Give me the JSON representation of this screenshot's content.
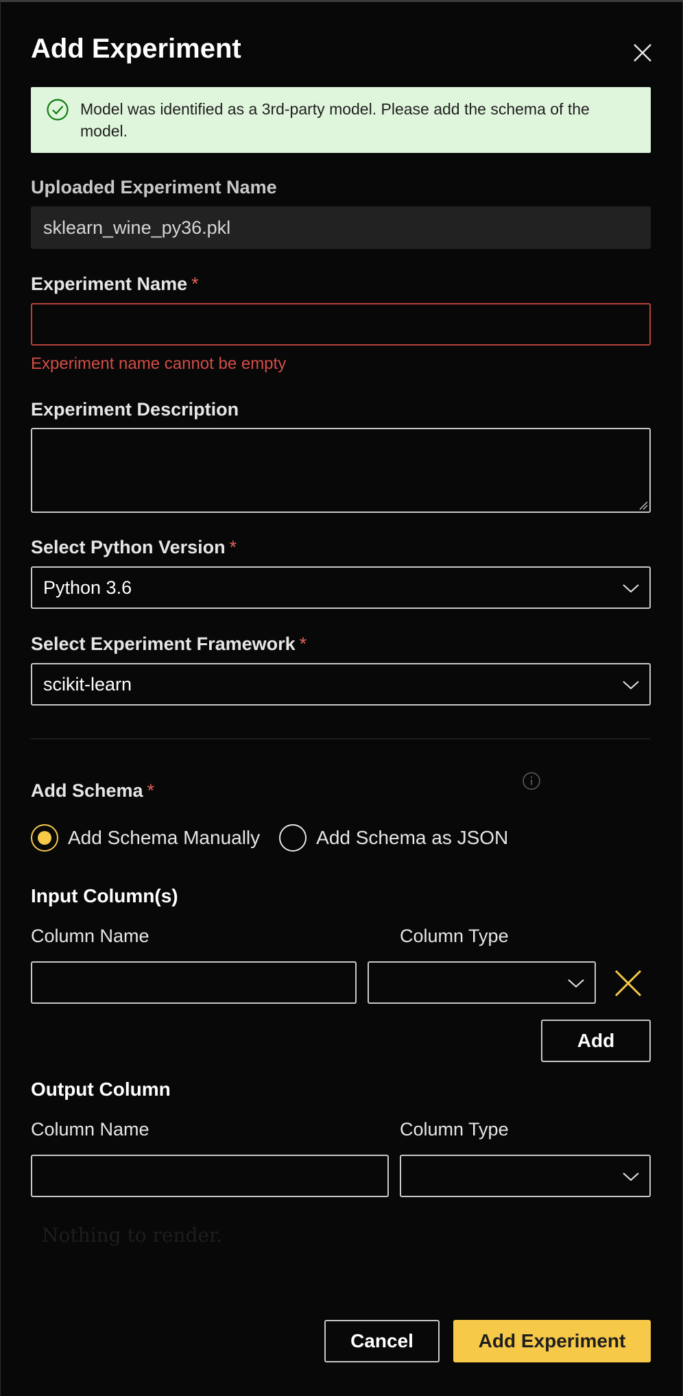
{
  "dialog": {
    "title": "Add Experiment"
  },
  "banner": {
    "message": "Model was identified as a 3rd-party model. Please add the schema of the model."
  },
  "uploaded_name": {
    "label": "Uploaded Experiment Name",
    "value": "sklearn_wine_py36.pkl"
  },
  "experiment_name": {
    "label": "Experiment Name",
    "required_mark": "*",
    "value": "",
    "error": "Experiment name cannot be empty"
  },
  "experiment_description": {
    "label": "Experiment Description",
    "value": ""
  },
  "python_version": {
    "label": "Select Python Version",
    "required_mark": "*",
    "selected": "Python 3.6"
  },
  "framework": {
    "label": "Select Experiment Framework",
    "required_mark": "*",
    "selected": "scikit-learn"
  },
  "schema": {
    "label": "Add Schema",
    "required_mark": "*",
    "options": [
      {
        "label": "Add Schema Manually",
        "selected": true
      },
      {
        "label": "Add Schema as JSON",
        "selected": false
      }
    ]
  },
  "input_columns": {
    "title": "Input Column(s)",
    "column_name_label": "Column Name",
    "column_type_label": "Column Type",
    "column_name_value": "",
    "column_type_value": "",
    "add_label": "Add"
  },
  "output_column": {
    "title": "Output Column",
    "column_name_label": "Column Name",
    "column_type_label": "Column Type",
    "column_name_value": "",
    "column_type_value": ""
  },
  "placeholder_text": "Nothing to render.",
  "footer": {
    "cancel_label": "Cancel",
    "submit_label": "Add Experiment"
  },
  "colors": {
    "accent": "#f7c948",
    "success_bg": "#dff6dd",
    "error": "#d24d47",
    "background": "#080808"
  },
  "icons": {
    "close": "close-icon",
    "success": "check-circle-icon",
    "chevron": "chevron-down-icon",
    "info": "info-icon",
    "remove": "remove-row-icon"
  }
}
